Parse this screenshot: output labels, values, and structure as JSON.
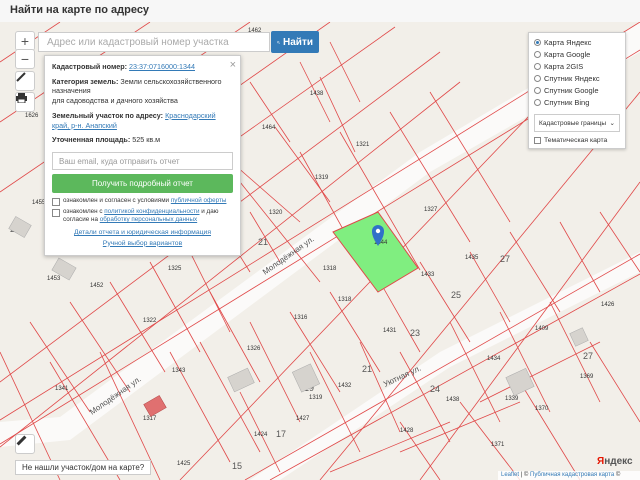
{
  "header": {
    "title": "Найти на карте по адресу"
  },
  "search": {
    "placeholder": "Адрес или кадастровый номер участка",
    "button_label": "Найти"
  },
  "controls": {
    "zoom_in": "+",
    "zoom_out": "−"
  },
  "popup": {
    "cadastral_label": "Кадастровый номер:",
    "cadastral_value": "23:37:0716000:1344",
    "category_label": "Категория земель:",
    "category_value": "Земли сельскохозяйственного назначения",
    "category_use": "для садоводства и дачного хозяйства",
    "address_label": "Земельный участок по адресу:",
    "address_value": "Краснодарский край, р-н. Анапский",
    "area_label": "Уточненная площадь:",
    "area_value": "525 кв.м",
    "email_placeholder": "Ваш email, куда отправить отчет",
    "report_button": "Получить подробный отчет",
    "agree_terms_text": "ознакомлен и согласен с условиями",
    "agree_terms_link": "публичной оферты",
    "agree_privacy_text1": "ознакомлен с",
    "agree_privacy_link1": "политикой конфиденциальности",
    "agree_privacy_text2": "и даю согласие на",
    "agree_privacy_link2": "обработку персональных данных",
    "details_link": "Детали отчета и юридическая информация",
    "manual_link": "Ручной выбор вариантов"
  },
  "layers": {
    "options": [
      {
        "label": "Карта Яндекс",
        "selected": true
      },
      {
        "label": "Карта Google",
        "selected": false
      },
      {
        "label": "Карта 2GIS",
        "selected": false
      },
      {
        "label": "Спутник Яндекс",
        "selected": false
      },
      {
        "label": "Спутник Google",
        "selected": false
      },
      {
        "label": "Спутник Bing",
        "selected": false
      }
    ],
    "select_value": "Кадастровые границы",
    "thematic_label": "Тематическая карта"
  },
  "not_found_label": "Не нашли участок/дом на карте?",
  "attribution": {
    "leaflet": "Leaflet",
    "sep": "|",
    "copy": "©",
    "public_map": "Публичная кадастровая карта",
    "copy2": "©"
  },
  "yandex_logo": {
    "y": "Я",
    "rest": "ндекс"
  },
  "map": {
    "highlight_color": "#80ee80",
    "boundary_color": "#e04848",
    "marker_color": "#3071c8",
    "parcels": [
      "1462",
      "1438",
      "1464",
      "1321",
      "1319",
      "1320",
      "1327",
      "1318",
      "1344",
      "1433",
      "1435",
      "1452",
      "1453",
      "1325",
      "1322",
      "1326",
      "1316",
      "1318",
      "1431",
      "1409",
      "1426",
      "1434",
      "1369",
      "1341",
      "1343",
      "1317",
      "1319",
      "1427",
      "1432",
      "1370",
      "1424",
      "1428",
      "1371",
      "1425",
      "1438",
      "1339",
      "1455",
      "1626"
    ],
    "street_labels": [
      "Молодёжная ул.",
      "Молодёжная ул.",
      "Уютная ул."
    ],
    "house_numbers": [
      "21",
      "27",
      "25",
      "23",
      "17",
      "19",
      "21",
      "24",
      "17",
      "15",
      "27",
      "21"
    ]
  }
}
